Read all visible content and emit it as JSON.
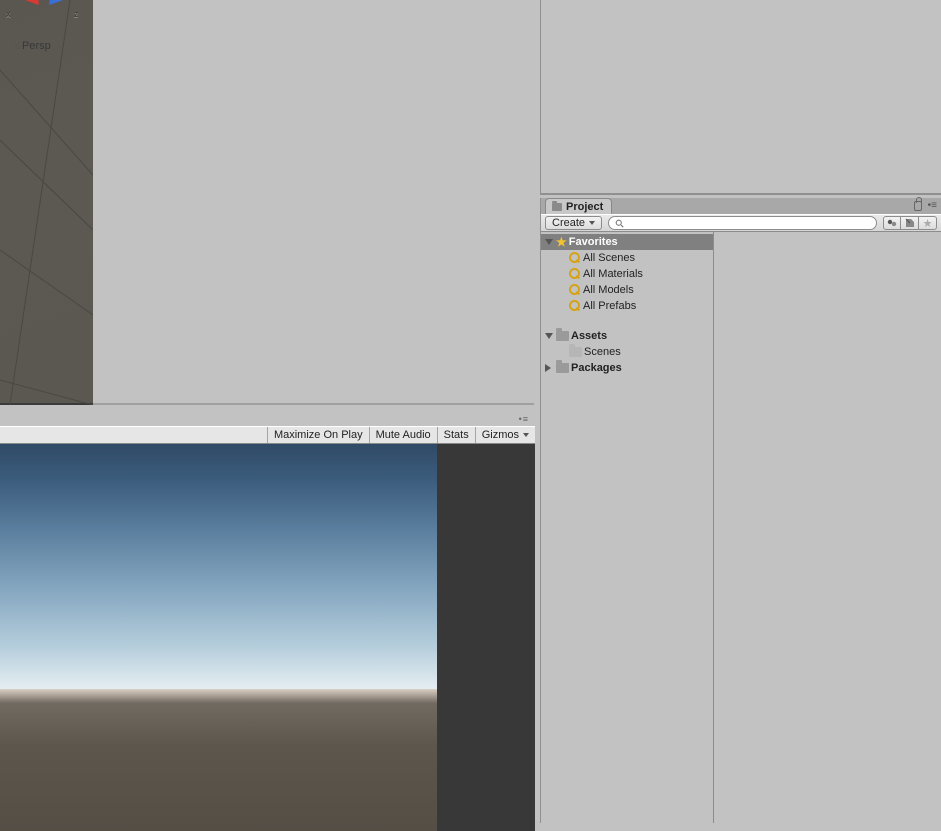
{
  "scene": {
    "axis_x": "x",
    "axis_z": "z",
    "perspective_label": "Persp"
  },
  "game_toolbar": {
    "maximize": "Maximize On Play",
    "mute": "Mute Audio",
    "stats": "Stats",
    "gizmos": "Gizmos"
  },
  "project": {
    "tab_label": "Project",
    "create_label": "Create",
    "search_placeholder": "",
    "tree": {
      "favorites": {
        "label": "Favorites",
        "items": [
          "All Scenes",
          "All Materials",
          "All Models",
          "All Prefabs"
        ]
      },
      "assets": {
        "label": "Assets",
        "items": [
          "Scenes"
        ]
      },
      "packages": {
        "label": "Packages"
      }
    }
  }
}
